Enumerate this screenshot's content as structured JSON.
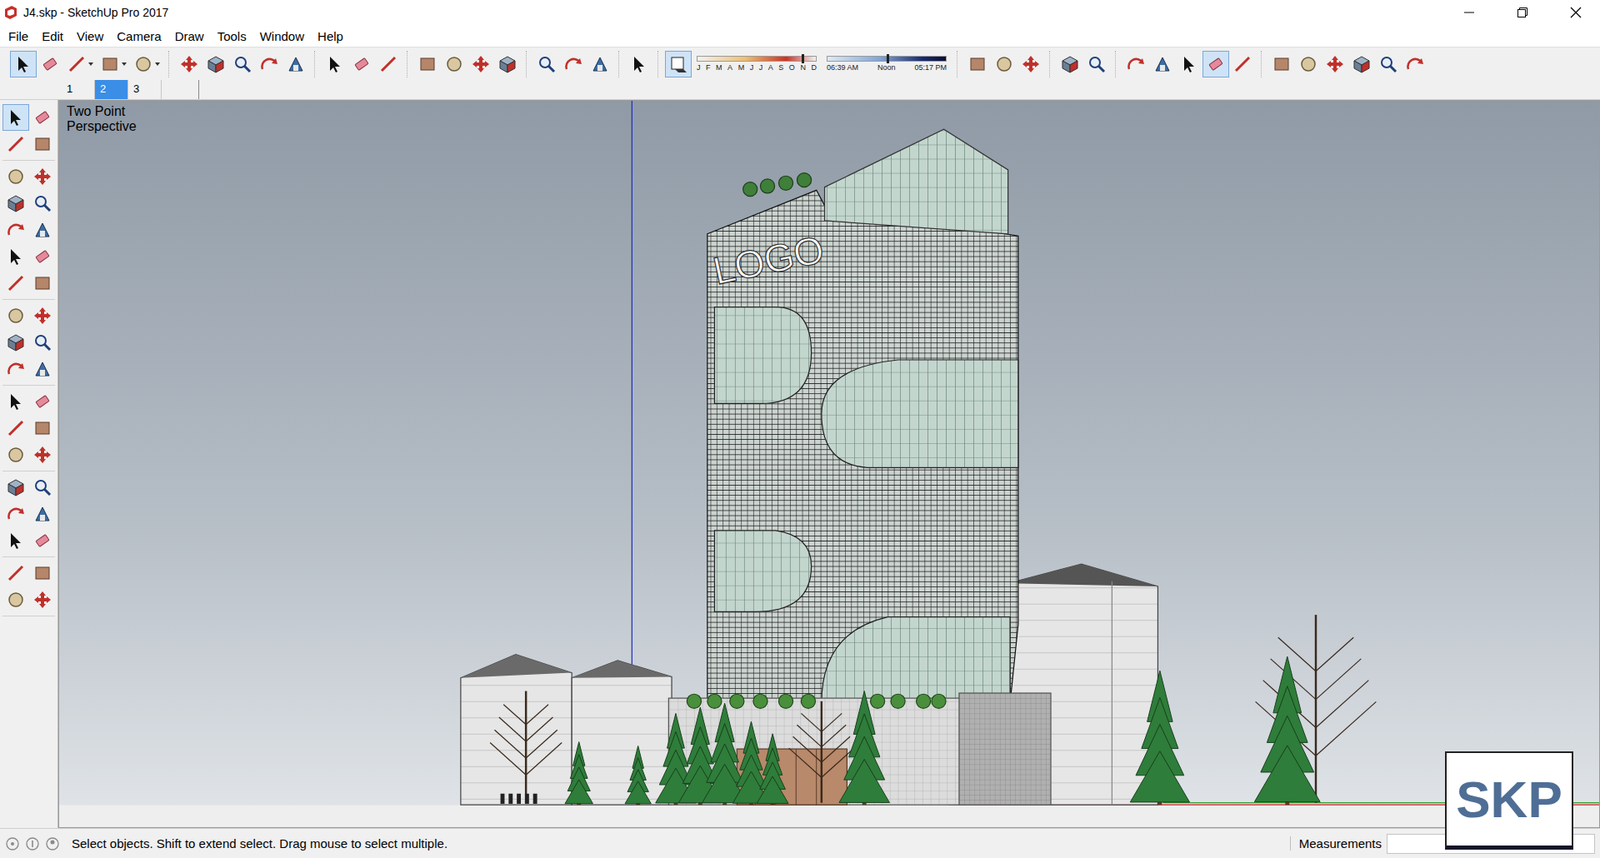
{
  "window": {
    "title": "J4.skp - SketchUp Pro 2017"
  },
  "menu": [
    "File",
    "Edit",
    "View",
    "Camera",
    "Draw",
    "Tools",
    "Window",
    "Help"
  ],
  "toolbar": {
    "leading_groups": [
      [
        {
          "kind": "button",
          "selected": true
        },
        {
          "kind": "button",
          "selected": false
        },
        {
          "kind": "split",
          "selected": false
        },
        {
          "kind": "split",
          "selected": false
        },
        {
          "kind": "split",
          "selected": false
        }
      ],
      [
        {
          "kind": "button",
          "selected": false
        },
        {
          "kind": "button",
          "selected": false
        },
        {
          "kind": "button",
          "selected": false
        },
        {
          "kind": "button",
          "selected": false
        },
        {
          "kind": "button",
          "selected": false
        }
      ],
      [
        {
          "kind": "button",
          "selected": false
        },
        {
          "kind": "button",
          "selected": false
        },
        {
          "kind": "button",
          "selected": false
        }
      ],
      [
        {
          "kind": "button",
          "selected": false
        },
        {
          "kind": "button",
          "selected": false
        },
        {
          "kind": "button",
          "selected": false
        },
        {
          "kind": "button",
          "selected": false
        }
      ],
      [
        {
          "kind": "button",
          "selected": false
        },
        {
          "kind": "button",
          "selected": false
        },
        {
          "kind": "button",
          "selected": false
        }
      ],
      [
        {
          "kind": "button",
          "selected": false
        }
      ]
    ],
    "shadow_settings": {
      "selected": true
    },
    "shadow_sliders": {
      "months": [
        "J",
        "F",
        "M",
        "A",
        "M",
        "J",
        "J",
        "A",
        "S",
        "O",
        "N",
        "D"
      ],
      "month_level": 0.88,
      "times": [
        "06:39 AM",
        "Noon",
        "05:17 PM"
      ],
      "time_level": 0.5
    },
    "trailing_groups": [
      [
        {
          "kind": "button",
          "selected": false
        },
        {
          "kind": "button",
          "selected": false
        },
        {
          "kind": "button",
          "selected": false
        }
      ],
      [
        {
          "kind": "button",
          "selected": false
        },
        {
          "kind": "button",
          "selected": false
        }
      ],
      [
        {
          "kind": "button",
          "selected": false
        },
        {
          "kind": "button",
          "selected": false
        },
        {
          "kind": "button",
          "selected": false
        },
        {
          "kind": "button",
          "selected": true
        },
        {
          "kind": "button",
          "selected": false
        }
      ],
      [
        {
          "kind": "button",
          "selected": false
        },
        {
          "kind": "button",
          "selected": false
        },
        {
          "kind": "button",
          "selected": false
        },
        {
          "kind": "button",
          "selected": false
        },
        {
          "kind": "button",
          "selected": false
        },
        {
          "kind": "button",
          "selected": false
        }
      ]
    ]
  },
  "scenes": [
    {
      "label": "1",
      "selected": false
    },
    {
      "label": "2",
      "selected": true
    },
    {
      "label": "3",
      "selected": false
    }
  ],
  "left_toolbar": {
    "groups": [
      [
        {
          "selected": true
        },
        {
          "selected": false
        },
        {
          "selected": false
        },
        {
          "selected": false
        }
      ],
      [
        {
          "selected": false
        },
        {
          "selected": false
        },
        {
          "selected": false
        },
        {
          "selected": false
        },
        {
          "selected": false
        },
        {
          "selected": false
        },
        {
          "selected": false
        },
        {
          "selected": false
        },
        {
          "selected": false
        },
        {
          "selected": false
        }
      ],
      [
        {
          "selected": false
        },
        {
          "selected": false
        },
        {
          "selected": false
        },
        {
          "selected": false
        },
        {
          "selected": false
        },
        {
          "selected": false
        }
      ],
      [
        {
          "selected": false
        },
        {
          "selected": false
        },
        {
          "selected": false
        },
        {
          "selected": false
        },
        {
          "selected": false
        },
        {
          "selected": false
        }
      ],
      [
        {
          "selected": false
        },
        {
          "selected": false
        },
        {
          "selected": false
        },
        {
          "selected": false
        },
        {
          "selected": false
        },
        {
          "selected": false
        }
      ],
      [
        {
          "selected": false
        },
        {
          "selected": false
        },
        {
          "selected": false
        },
        {
          "selected": false
        }
      ]
    ]
  },
  "viewport": {
    "camera_label": "Two Point Perspective",
    "logo_text": "LOGO"
  },
  "watermark": "SKP",
  "status_bar": {
    "message": "Select objects. Shift to extend select. Drag mouse to select multiple.",
    "measurements_label": "Measurements",
    "measurements_value": ""
  }
}
